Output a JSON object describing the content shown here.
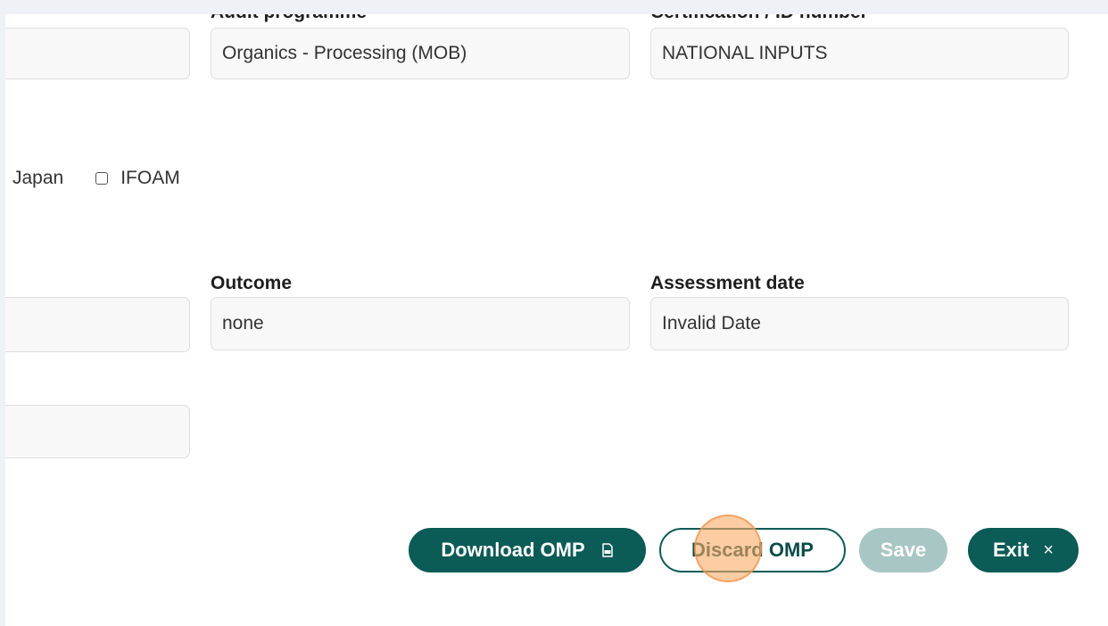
{
  "audit": {
    "programme_label": "Audit programme",
    "programme_value": "Organics - Processing (MOB)",
    "cert_label": "Certification / ID number",
    "cert_value": "NATIONAL INPUTS",
    "left_field_value": ""
  },
  "standards": {
    "options": [
      {
        "label": "Japan",
        "checked": false
      },
      {
        "label": "IFOAM",
        "checked": false
      }
    ]
  },
  "assessment": {
    "outcome_label": "Outcome",
    "outcome_value": "none",
    "date_label": "Assessment date",
    "date_value": "Invalid Date",
    "left_field_value": ""
  },
  "extra": {
    "left_field_value": ""
  },
  "actions": {
    "download_label": "Download OMP",
    "discard_label": "Discard OMP",
    "save_label": "Save",
    "exit_label": "Exit",
    "exit_symbol": "×",
    "save_disabled": true
  },
  "colors": {
    "primary": "#0b5b56",
    "disabled": "#a8c7c4",
    "click_marker": "#f7a460"
  },
  "icons": {
    "download": "pdf-file-icon",
    "exit": "close-icon"
  }
}
